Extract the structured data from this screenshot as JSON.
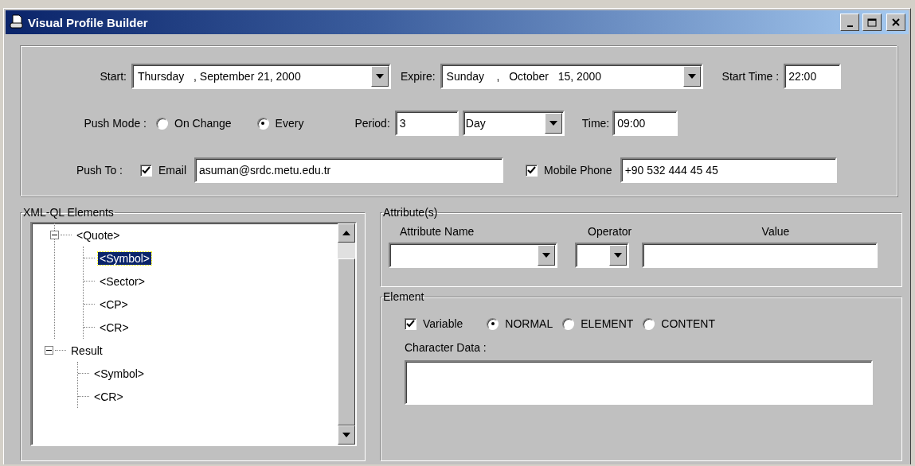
{
  "window": {
    "title": "Visual Profile Builder"
  },
  "schedule": {
    "start_label": "Start:",
    "start_value": "Thursday   , September 21, 2000",
    "expire_label": "Expire:",
    "expire_value": "Sunday    ,   October   15, 2000",
    "start_time_label": "Start Time :",
    "start_time_value": "22:00"
  },
  "push_mode": {
    "label": "Push Mode :",
    "options": [
      {
        "label": "On Change",
        "selected": false
      },
      {
        "label": "Every",
        "selected": true
      }
    ],
    "period_label": "Period:",
    "period_value": "3",
    "unit_value": "Day",
    "time_label": "Time:",
    "time_value": "09:00"
  },
  "push_to": {
    "label": "Push To :",
    "targets": [
      {
        "label": "Email",
        "checked": true,
        "value": "asuman@srdc.metu.edu.tr"
      },
      {
        "label": "Mobile Phone",
        "checked": true,
        "value": "+90 532 444 45 45"
      }
    ]
  },
  "elements_panel": {
    "title": "XML-QL Elements",
    "tree": [
      {
        "children": [
          {
            "label": "<Quote>",
            "expanded": true,
            "selected": false,
            "children": [
              {
                "label": "<Symbol>",
                "selected": true
              },
              {
                "label": "<Sector>",
                "selected": false
              },
              {
                "label": "<CP>",
                "selected": false
              },
              {
                "label": "<CR>",
                "selected": false
              }
            ]
          }
        ]
      },
      {
        "label": "Result",
        "expanded": true,
        "selected": false,
        "children": [
          {
            "label": "<Symbol>",
            "selected": false
          },
          {
            "label": "<CR>",
            "selected": false
          }
        ]
      }
    ]
  },
  "attributes_panel": {
    "title": "Attribute(s)",
    "columns": [
      "Attribute Name",
      "Operator",
      "Value"
    ]
  },
  "element_panel": {
    "title": "Element",
    "variable": {
      "label": "Variable",
      "checked": true
    },
    "modes": [
      {
        "label": "NORMAL",
        "selected": true
      },
      {
        "label": "ELEMENT",
        "selected": false
      },
      {
        "label": "CONTENT",
        "selected": false
      }
    ],
    "character_data_label": "Character Data :"
  }
}
